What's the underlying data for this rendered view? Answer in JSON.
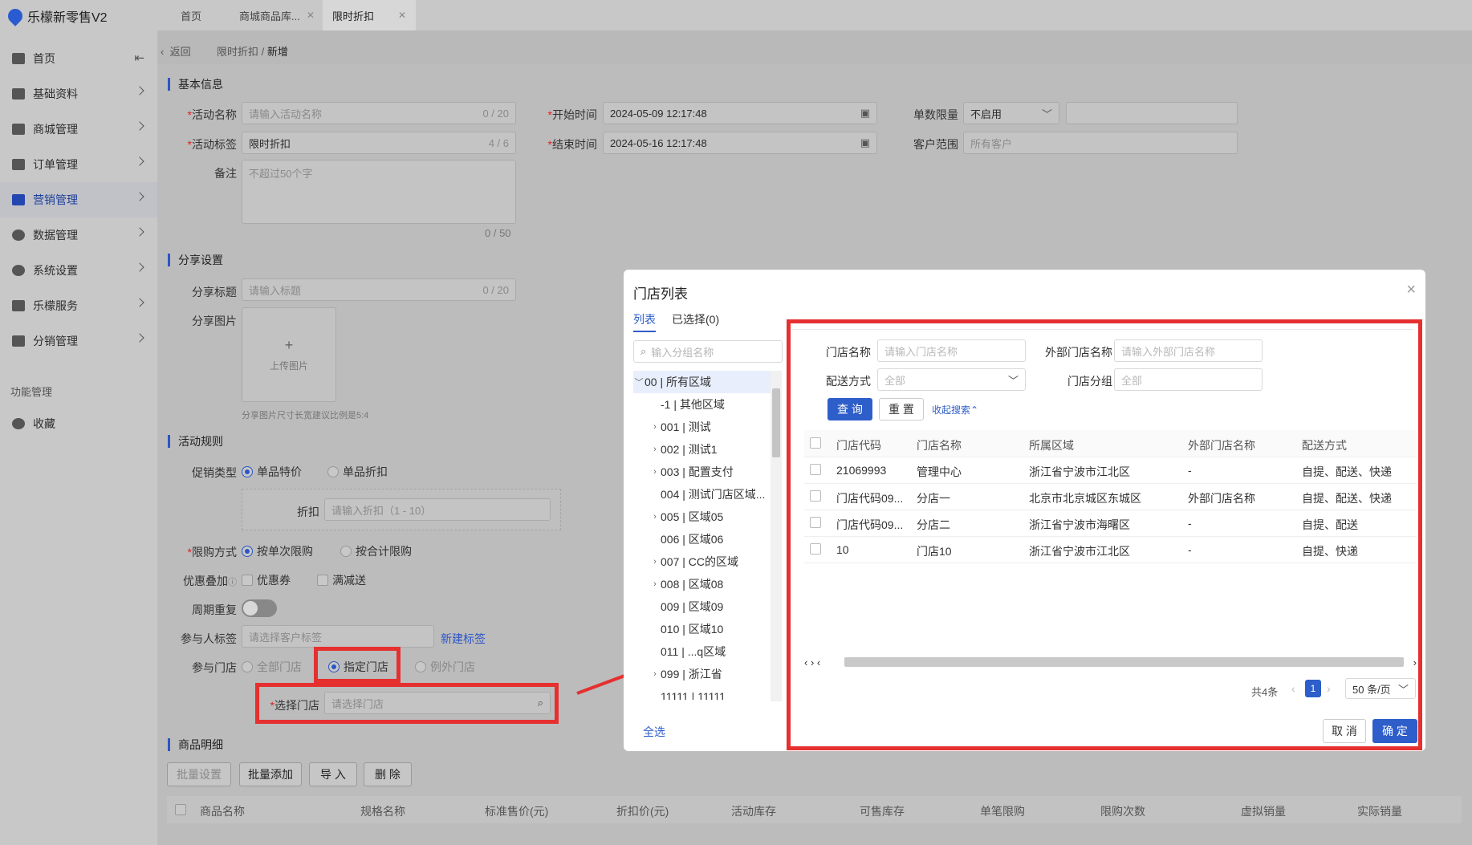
{
  "app": {
    "title": "乐檬新零售V2"
  },
  "sidebar": {
    "items": [
      {
        "label": "首页"
      },
      {
        "label": "基础资料"
      },
      {
        "label": "商城管理"
      },
      {
        "label": "订单管理"
      },
      {
        "label": "营销管理"
      },
      {
        "label": "数据管理"
      },
      {
        "label": "系统设置"
      },
      {
        "label": "乐檬服务"
      },
      {
        "label": "分销管理"
      }
    ],
    "group_label": "功能管理",
    "favorites_label": "收藏"
  },
  "tabs": [
    {
      "label": "首页"
    },
    {
      "label": "商城商品库..."
    },
    {
      "label": "限时折扣"
    }
  ],
  "breadcrumb": {
    "back": "返回",
    "parent": "限时折扣 /",
    "current": "新增"
  },
  "basic": {
    "title": "基本信息",
    "name_label": "活动名称",
    "name_placeholder": "请输入活动名称",
    "name_count": "0 / 20",
    "tag_label": "活动标签",
    "tag_value": "限时折扣",
    "tag_count": "4 / 6",
    "remark_label": "备注",
    "remark_placeholder": "不超过50个字",
    "remark_count": "0 / 50",
    "start_label": "开始时间",
    "start_value": "2024-05-09 12:17:48",
    "end_label": "结束时间",
    "end_value": "2024-05-16 12:17:48",
    "limit_label": "单数限量",
    "limit_value": "不启用",
    "customer_label": "客户范围",
    "customer_placeholder": "所有客户"
  },
  "share": {
    "title": "分享设置",
    "title_label": "分享标题",
    "title_placeholder": "请输入标题",
    "title_count": "0 / 20",
    "image_label": "分享图片",
    "upload_label": "上传图片",
    "upload_plus": "+",
    "hint": "分享图片尺寸长宽建议比例是5:4"
  },
  "rules": {
    "title": "活动规则",
    "promo_type_label": "促销类型",
    "promo_opt1": "单品特价",
    "promo_opt2": "单品折扣",
    "discount_label": "折扣",
    "discount_placeholder": "请输入折扣（1 - 10）",
    "limit_mode_label": "限购方式",
    "limit_opt1": "按单次限购",
    "limit_opt2": "按合计限购",
    "stack_label": "优惠叠加",
    "stack_opt1": "优惠券",
    "stack_opt2": "满减送",
    "cycle_label": "周期重复",
    "member_tag_label": "参与人标签",
    "member_tag_placeholder": "请选择客户标签",
    "new_tag": "新建标签",
    "store_label": "参与门店",
    "store_opt1": "全部门店",
    "store_opt2": "指定门店",
    "store_opt3": "例外门店",
    "select_store_label": "选择门店",
    "select_store_placeholder": "请选择门店"
  },
  "goods": {
    "title": "商品明细",
    "btn_batch_set": "批量设置",
    "btn_batch_add": "批量添加",
    "btn_import": "导 入",
    "btn_delete": "删 除",
    "columns": [
      "商品名称",
      "规格名称",
      "标准售价(元)",
      "折扣价(元)",
      "活动库存",
      "可售库存",
      "单笔限购",
      "限购次数",
      "虚拟销量",
      "实际销量"
    ]
  },
  "modal": {
    "title": "门店列表",
    "close": "×",
    "tab_list": "列表",
    "tab_selected": "已选择(0)",
    "group_search_placeholder": "输入分组名称",
    "tree": [
      {
        "label": "00 | 所有区域",
        "arrow": "﹀"
      },
      {
        "label": "-1 | 其他区域",
        "arrow": ""
      },
      {
        "label": "001 | 测试",
        "arrow": "›"
      },
      {
        "label": "002 | 测试1",
        "arrow": "›"
      },
      {
        "label": "003 | 配置支付",
        "arrow": "›"
      },
      {
        "label": "004 | 测试门店区域...",
        "arrow": ""
      },
      {
        "label": "005 | 区域05",
        "arrow": "›"
      },
      {
        "label": "006 | 区域06",
        "arrow": ""
      },
      {
        "label": "007 | CC的区域",
        "arrow": "›"
      },
      {
        "label": "008 | 区域08",
        "arrow": "›"
      },
      {
        "label": "009 | 区域09",
        "arrow": ""
      },
      {
        "label": "010 | 区域10",
        "arrow": ""
      },
      {
        "label": "011 | ...q区域",
        "arrow": ""
      },
      {
        "label": "099 | 浙江省",
        "arrow": "›"
      },
      {
        "label": "11111 | 11111",
        "arrow": ""
      }
    ],
    "select_all": "全选",
    "filter": {
      "store_name_label": "门店名称",
      "store_name_placeholder": "请输入门店名称",
      "ext_name_label": "外部门店名称",
      "ext_name_placeholder": "请输入外部门店名称",
      "delivery_label": "配送方式",
      "delivery_value": "全部",
      "group_label": "门店分组",
      "group_value": "全部",
      "query": "查 询",
      "reset": "重 置",
      "collapse": "收起搜索"
    },
    "table": {
      "columns": [
        "门店代码",
        "门店名称",
        "所属区域",
        "外部门店名称",
        "配送方式"
      ],
      "rows": [
        [
          "21069993",
          "管理中心",
          "浙江省宁波市江北区",
          "-",
          "自提、配送、快递"
        ],
        [
          "门店代码09...",
          "分店一",
          "北京市北京城区东城区",
          "外部门店名称",
          "自提、配送、快递"
        ],
        [
          "门店代码09...",
          "分店二",
          "浙江省宁波市海曙区",
          "-",
          "自提、配送"
        ],
        [
          "10",
          "门店10",
          "浙江省宁波市江北区",
          "-",
          "自提、快递"
        ]
      ]
    },
    "pagination": {
      "total": "共4条",
      "page": "1",
      "page_size": "50 条/页"
    },
    "cancel": "取 消",
    "confirm": "确 定"
  },
  "colors": {
    "accent": "#2d5ec9",
    "highlight": "#e5302f"
  }
}
